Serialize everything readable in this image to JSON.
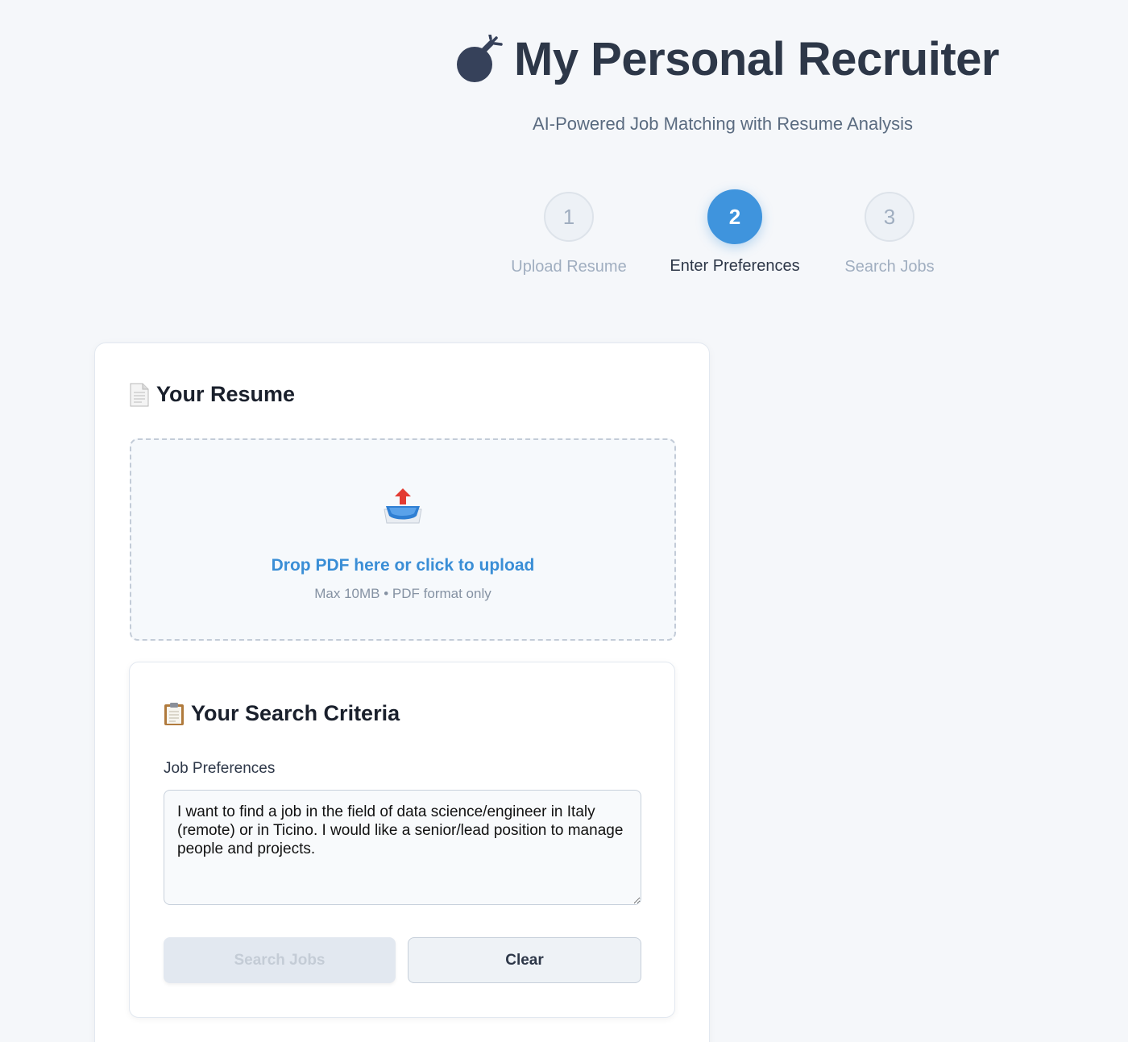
{
  "header": {
    "title": "My Personal Recruiter",
    "title_icon": "bomb-icon",
    "subtitle": "AI-Powered Job Matching with Resume Analysis"
  },
  "steps": [
    {
      "number": "1",
      "label": "Upload Resume",
      "state": "inactive"
    },
    {
      "number": "2",
      "label": "Enter Preferences",
      "state": "active"
    },
    {
      "number": "3",
      "label": "Search Jobs",
      "state": "inactive"
    }
  ],
  "resume": {
    "heading_icon": "document-icon",
    "heading": "Your Resume",
    "upload_icon": "outbox-tray-icon",
    "drop_title": "Drop PDF here or click to upload",
    "drop_sub": "Max 10MB • PDF format only"
  },
  "criteria": {
    "heading_icon": "clipboard-icon",
    "heading": "Your Search Criteria",
    "field_label": "Job Preferences",
    "preferences_value": "I want to find a job in the field of data science/engineer in Italy (remote) or in Ticino. I would like a senior/lead position to manage people and projects.",
    "search_button": "Search Jobs",
    "search_button_state": "disabled",
    "clear_button": "Clear"
  },
  "colors": {
    "background": "#f5f7fa",
    "accent": "#3f94dd",
    "title": "#2d3748",
    "link": "#3a8ed6"
  }
}
